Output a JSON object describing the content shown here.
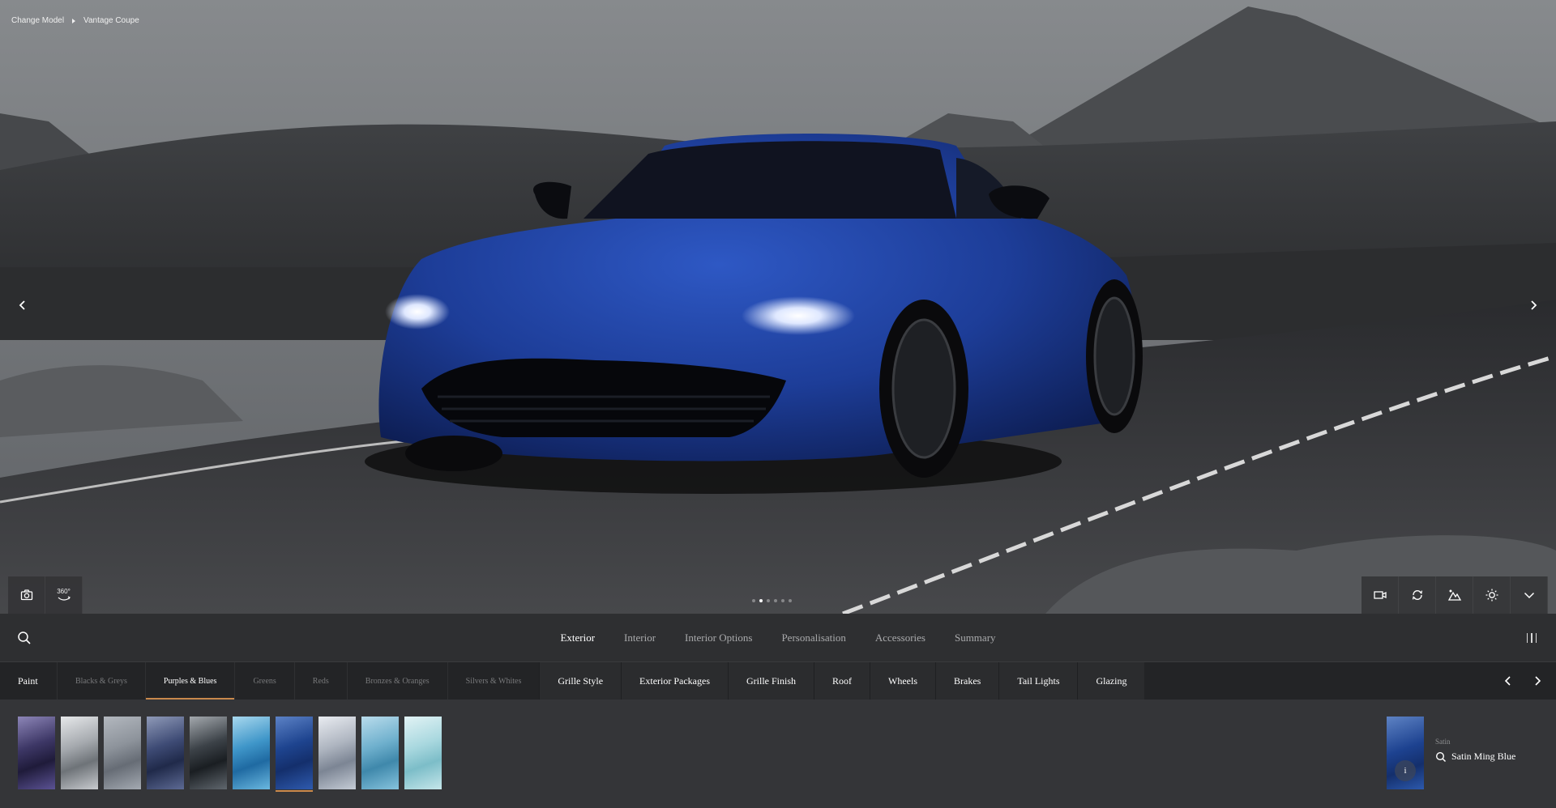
{
  "breadcrumb": {
    "first": "Change Model",
    "second": "Vantage Coupe"
  },
  "viewer": {
    "toolbar_left": [
      {
        "icon": "camera-icon"
      },
      {
        "icon": "360-view-icon",
        "label": "360°"
      }
    ],
    "toolbar_right": [
      {
        "icon": "video-camera-icon"
      },
      {
        "icon": "rotate-icon"
      },
      {
        "icon": "environment-icon"
      },
      {
        "icon": "light-icon"
      },
      {
        "icon": "chevron-down-icon"
      }
    ],
    "dot_count": 6,
    "active_dot": 1
  },
  "main_nav": {
    "tabs": [
      {
        "label": "Exterior",
        "active": true
      },
      {
        "label": "Interior",
        "active": false
      },
      {
        "label": "Interior Options",
        "active": false
      },
      {
        "label": "Personalisation",
        "active": false
      },
      {
        "label": "Accessories",
        "active": false
      },
      {
        "label": "Summary",
        "active": false
      }
    ]
  },
  "sub_nav": {
    "paint_label": "Paint",
    "filters": [
      {
        "label": "Blacks & Greys",
        "active": false
      },
      {
        "label": "Purples & Blues",
        "active": true
      },
      {
        "label": "Greens",
        "active": false
      },
      {
        "label": "Reds",
        "active": false
      },
      {
        "label": "Bronzes & Oranges",
        "active": false
      },
      {
        "label": "Silvers & Whites",
        "active": false
      }
    ],
    "categories": [
      "Grille Style",
      "Exterior Packages",
      "Grille Finish",
      "Roof",
      "Wheels",
      "Brakes",
      "Tail Lights",
      "Glazing"
    ]
  },
  "swatches": [
    {
      "colors": [
        "#8d86b8",
        "#3d3766",
        "#1f1b3a",
        "#5b5294"
      ],
      "selected": false
    },
    {
      "colors": [
        "#e6e8ea",
        "#a5a9ae",
        "#6e7378",
        "#c8cbcf"
      ],
      "selected": false
    },
    {
      "colors": [
        "#b3b8bf",
        "#8d939b",
        "#666c75",
        "#a4aab2"
      ],
      "selected": false
    },
    {
      "colors": [
        "#8f9ab8",
        "#3e4b75",
        "#202a4a",
        "#5d6a94"
      ],
      "selected": false
    },
    {
      "colors": [
        "#a4a9ae",
        "#3c4248",
        "#1a1e22",
        "#60676e"
      ],
      "selected": false
    },
    {
      "colors": [
        "#a8d8ee",
        "#3f96c9",
        "#1f6aa2",
        "#6ab8e0"
      ],
      "selected": false
    },
    {
      "colors": [
        "#5c82c6",
        "#1e448f",
        "#142f6c",
        "#2e5aae"
      ],
      "selected": true
    },
    {
      "colors": [
        "#e9ecf1",
        "#aeb5c0",
        "#7c8594",
        "#c5ccd6"
      ],
      "selected": false
    },
    {
      "colors": [
        "#b9dcec",
        "#6fb0cd",
        "#3f88ab",
        "#86c3dd"
      ],
      "selected": false
    },
    {
      "colors": [
        "#e2f3f5",
        "#a9d8df",
        "#7cbdc8",
        "#c5e6ea"
      ],
      "selected": false
    }
  ],
  "selection": {
    "finish": "Satin",
    "name": "Satin Ming Blue",
    "info_icon": "i"
  },
  "colors": {
    "accent": "#c9894c",
    "car_body": "#1f3f9a"
  }
}
